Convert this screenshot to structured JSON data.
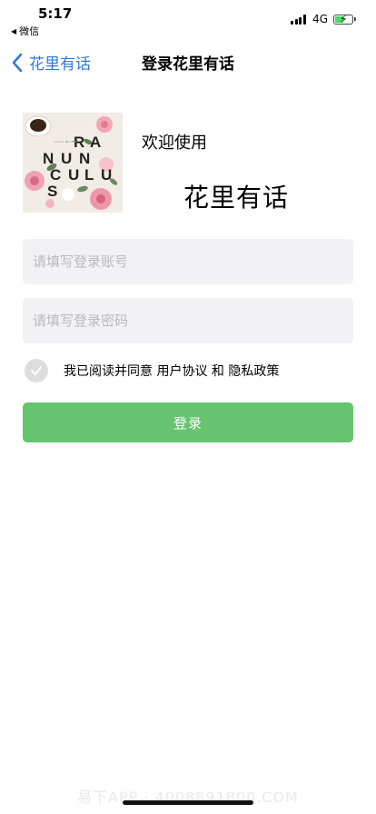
{
  "status_bar": {
    "time": "5:17",
    "back_app": "微信",
    "network": "4G"
  },
  "nav": {
    "back_label": "花里有话",
    "title": "登录花里有话"
  },
  "brand": {
    "welcome": "欢迎使用",
    "name": "花里有话",
    "image_icon": "flower-poster-image"
  },
  "form": {
    "account_placeholder": "请填写登录账号",
    "account_value": "",
    "password_placeholder": "请填写登录密码",
    "password_value": ""
  },
  "agreement": {
    "prefix": "我已阅读并同意 ",
    "user_agreement": "用户协议",
    "conjunction": " 和 ",
    "privacy_policy": "隐私政策",
    "checked": false
  },
  "login_button": "登录",
  "watermark": "易下APP · 4008891800.COM",
  "colors": {
    "accent_blue": "#2f7bdc",
    "button_green": "#66c46e",
    "input_bg": "#f2f2f5"
  }
}
